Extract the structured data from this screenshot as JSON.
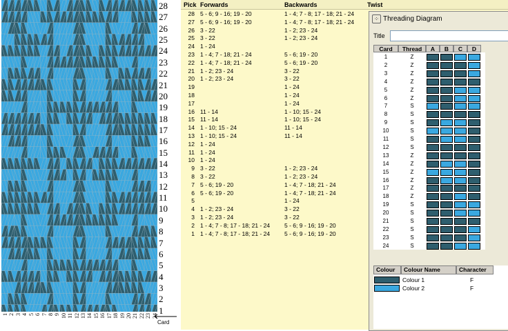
{
  "weave": {
    "colors": {
      "dark": "#2e5e6e",
      "light": "#3aa8e0",
      "line": "#9fb7c2"
    },
    "picks": 28,
    "cards": 24
  },
  "pick_labels": [
    "28",
    "27",
    "26",
    "25",
    "24",
    "23",
    "22",
    "21",
    "20",
    "19",
    "18",
    "17",
    "16",
    "15",
    "14",
    "13",
    "12",
    "11",
    "10",
    "9",
    "8",
    "7",
    "6",
    "5",
    "4",
    "3",
    "2",
    "1"
  ],
  "card_labels": [
    "1",
    "2",
    "3",
    "4",
    "5",
    "6",
    "7",
    "8",
    "9",
    "10",
    "11",
    "12",
    "13",
    "14",
    "15",
    "16",
    "17",
    "18",
    "19",
    "20",
    "21",
    "22",
    "23",
    "24"
  ],
  "card_axis_label": "Card",
  "table": {
    "headers": {
      "pick": "Pick",
      "forwards": "Forwards",
      "backwards": "Backwards",
      "twist": "Twist"
    },
    "rows": [
      {
        "pick": "28",
        "fwd": "5 - 6; 9 - 16; 19 - 20",
        "bwd": "1 - 4; 7 - 8; 17 - 18; 21 - 24"
      },
      {
        "pick": "27",
        "fwd": "5 - 6; 9 - 16; 19 - 20",
        "bwd": "1 - 4; 7 - 8; 17 - 18; 21 - 24"
      },
      {
        "pick": "26",
        "fwd": "3 - 22",
        "bwd": "1 - 2; 23 - 24"
      },
      {
        "pick": "25",
        "fwd": "3 - 22",
        "bwd": "1 - 2; 23 - 24"
      },
      {
        "pick": "24",
        "fwd": "1 - 24",
        "bwd": ""
      },
      {
        "pick": "23",
        "fwd": "1 - 4; 7 - 18; 21 - 24",
        "bwd": "5 - 6; 19 - 20"
      },
      {
        "pick": "22",
        "fwd": "1 - 4; 7 - 18; 21 - 24",
        "bwd": "5 - 6; 19 - 20"
      },
      {
        "pick": "21",
        "fwd": "1 - 2; 23 - 24",
        "bwd": "3 - 22"
      },
      {
        "pick": "20",
        "fwd": "1 - 2; 23 - 24",
        "bwd": "3 - 22"
      },
      {
        "pick": "19",
        "fwd": "",
        "bwd": "1 - 24"
      },
      {
        "pick": "18",
        "fwd": "",
        "bwd": "1 - 24"
      },
      {
        "pick": "17",
        "fwd": "",
        "bwd": "1 - 24"
      },
      {
        "pick": "16",
        "fwd": "11 - 14",
        "bwd": "1 - 10; 15 - 24"
      },
      {
        "pick": "15",
        "fwd": "11 - 14",
        "bwd": "1 - 10; 15 - 24"
      },
      {
        "pick": "14",
        "fwd": "1 - 10; 15 - 24",
        "bwd": "11 - 14"
      },
      {
        "pick": "13",
        "fwd": "1 - 10; 15 - 24",
        "bwd": "11 - 14"
      },
      {
        "pick": "12",
        "fwd": "1 - 24",
        "bwd": ""
      },
      {
        "pick": "11",
        "fwd": "1 - 24",
        "bwd": ""
      },
      {
        "pick": "10",
        "fwd": "1 - 24",
        "bwd": ""
      },
      {
        "pick": "9",
        "fwd": "3 - 22",
        "bwd": "1 - 2; 23 - 24"
      },
      {
        "pick": "8",
        "fwd": "3 - 22",
        "bwd": "1 - 2; 23 - 24"
      },
      {
        "pick": "7",
        "fwd": "5 - 6; 19 - 20",
        "bwd": "1 - 4; 7 - 18; 21 - 24"
      },
      {
        "pick": "6",
        "fwd": "5 - 6; 19 - 20",
        "bwd": "1 - 4; 7 - 18; 21 - 24"
      },
      {
        "pick": "5",
        "fwd": "",
        "bwd": "1 - 24"
      },
      {
        "pick": "4",
        "fwd": "1 - 2; 23 - 24",
        "bwd": "3 - 22"
      },
      {
        "pick": "3",
        "fwd": "1 - 2; 23 - 24",
        "bwd": "3 - 22"
      },
      {
        "pick": "2",
        "fwd": "1 - 4; 7 - 8; 17 - 18; 21 - 24",
        "bwd": "5 - 6; 9 - 16; 19 - 20"
      },
      {
        "pick": "1",
        "fwd": "1 - 4; 7 - 8; 17 - 18; 21 - 24",
        "bwd": "5 - 6; 9 - 16; 19 - 20"
      }
    ]
  },
  "threading": {
    "window_title": "Threading Diagram",
    "title_label": "Title",
    "title_value": "",
    "columns": [
      "Card",
      "Thread",
      "A",
      "B",
      "C",
      "D"
    ],
    "rows": [
      {
        "card": "1",
        "thread": "Z",
        "holes": [
          1,
          1,
          2,
          2
        ]
      },
      {
        "card": "2",
        "thread": "Z",
        "holes": [
          1,
          1,
          1,
          2
        ]
      },
      {
        "card": "3",
        "thread": "Z",
        "holes": [
          1,
          1,
          1,
          2
        ]
      },
      {
        "card": "4",
        "thread": "Z",
        "holes": [
          1,
          1,
          1,
          1
        ]
      },
      {
        "card": "5",
        "thread": "Z",
        "holes": [
          1,
          1,
          2,
          2
        ]
      },
      {
        "card": "6",
        "thread": "Z",
        "holes": [
          1,
          1,
          2,
          2
        ]
      },
      {
        "card": "7",
        "thread": "S",
        "holes": [
          2,
          1,
          2,
          2
        ]
      },
      {
        "card": "8",
        "thread": "S",
        "holes": [
          1,
          1,
          1,
          1
        ]
      },
      {
        "card": "9",
        "thread": "S",
        "holes": [
          1,
          2,
          2,
          1
        ]
      },
      {
        "card": "10",
        "thread": "S",
        "holes": [
          2,
          2,
          2,
          1
        ]
      },
      {
        "card": "11",
        "thread": "S",
        "holes": [
          1,
          2,
          2,
          1
        ]
      },
      {
        "card": "12",
        "thread": "S",
        "holes": [
          1,
          1,
          1,
          1
        ]
      },
      {
        "card": "13",
        "thread": "Z",
        "holes": [
          1,
          1,
          1,
          1
        ]
      },
      {
        "card": "14",
        "thread": "Z",
        "holes": [
          1,
          2,
          2,
          1
        ]
      },
      {
        "card": "15",
        "thread": "Z",
        "holes": [
          2,
          2,
          2,
          1
        ]
      },
      {
        "card": "16",
        "thread": "Z",
        "holes": [
          1,
          2,
          2,
          1
        ]
      },
      {
        "card": "17",
        "thread": "Z",
        "holes": [
          1,
          1,
          1,
          1
        ]
      },
      {
        "card": "18",
        "thread": "Z",
        "holes": [
          1,
          1,
          2,
          1
        ]
      },
      {
        "card": "19",
        "thread": "S",
        "holes": [
          1,
          1,
          2,
          2
        ]
      },
      {
        "card": "20",
        "thread": "S",
        "holes": [
          1,
          1,
          2,
          2
        ]
      },
      {
        "card": "21",
        "thread": "S",
        "holes": [
          1,
          1,
          1,
          1
        ]
      },
      {
        "card": "22",
        "thread": "S",
        "holes": [
          1,
          1,
          1,
          2
        ]
      },
      {
        "card": "23",
        "thread": "S",
        "holes": [
          1,
          1,
          1,
          2
        ]
      },
      {
        "card": "24",
        "thread": "S",
        "holes": [
          1,
          1,
          2,
          2
        ]
      }
    ],
    "colour_table": {
      "columns": [
        "Colour",
        "Colour Name",
        "Character"
      ],
      "rows": [
        {
          "color": "#2e5e6e",
          "name": "Colour 1",
          "char": "F"
        },
        {
          "color": "#3aa8e0",
          "name": "Colour 2",
          "char": "F"
        }
      ]
    }
  }
}
